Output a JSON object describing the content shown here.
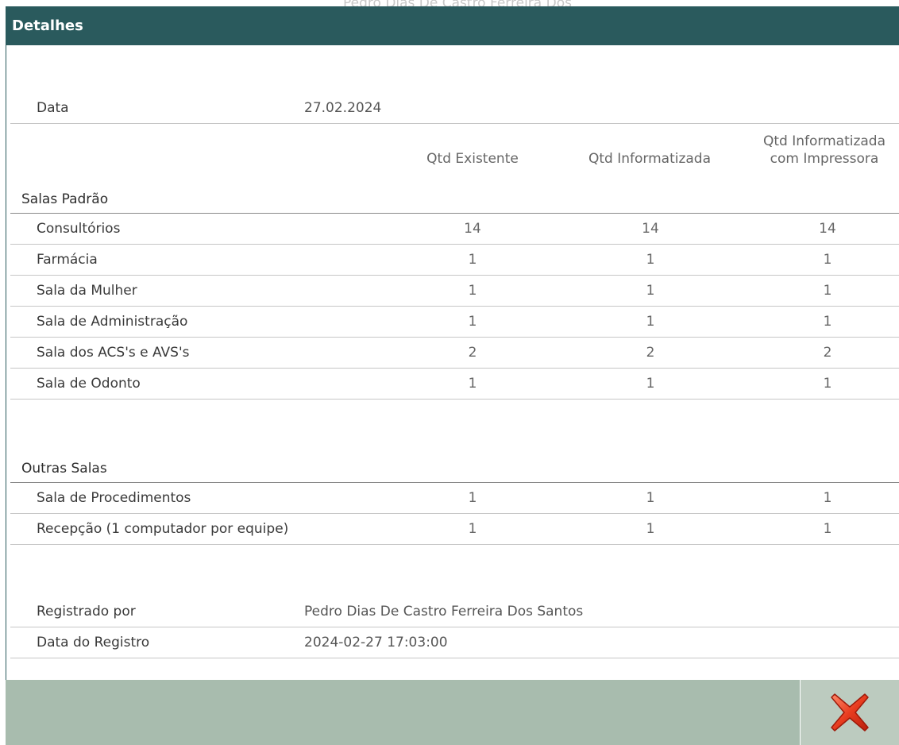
{
  "background_text": "Pedro Dias De Castro Ferreira Dos",
  "dialog": {
    "title": "Detalhes",
    "date_label": "Data",
    "date_value": "27.02.2024",
    "columns": [
      "Qtd Existente",
      "Qtd Informatizada",
      "Qtd Informatizada com Impressora"
    ],
    "columns_third_lines": [
      "Qtd Informatizada",
      "com Impressora"
    ],
    "sections": [
      {
        "title": "Salas Padrão",
        "rows": [
          {
            "label": "Consultórios",
            "existente": "14",
            "informatizada": "14",
            "impressora": "14"
          },
          {
            "label": "Farmácia",
            "existente": "1",
            "informatizada": "1",
            "impressora": "1"
          },
          {
            "label": "Sala da Mulher",
            "existente": "1",
            "informatizada": "1",
            "impressora": "1"
          },
          {
            "label": "Sala de Administração",
            "existente": "1",
            "informatizada": "1",
            "impressora": "1"
          },
          {
            "label": "Sala dos ACS's e AVS's",
            "existente": "2",
            "informatizada": "2",
            "impressora": "2"
          },
          {
            "label": "Sala de Odonto",
            "existente": "1",
            "informatizada": "1",
            "impressora": "1"
          }
        ]
      },
      {
        "title": "Outras Salas",
        "rows": [
          {
            "label": "Sala de Procedimentos",
            "existente": "1",
            "informatizada": "1",
            "impressora": "1"
          },
          {
            "label": "Recepção (1 computador por equipe)",
            "existente": "1",
            "informatizada": "1",
            "impressora": "1"
          }
        ]
      }
    ],
    "registered_by_label": "Registrado por",
    "registered_by_value": "Pedro Dias De Castro Ferreira Dos Santos",
    "registered_date_label": "Data do Registro",
    "registered_date_value": "2024-02-27 17:03:00"
  },
  "footer": {
    "close_icon": "close-x-icon"
  },
  "colors": {
    "header_bg": "#2a5a5d",
    "footer_bg": "#a8bcae",
    "close_bg": "#bccbbf",
    "close_icon": "#e03a1e"
  }
}
